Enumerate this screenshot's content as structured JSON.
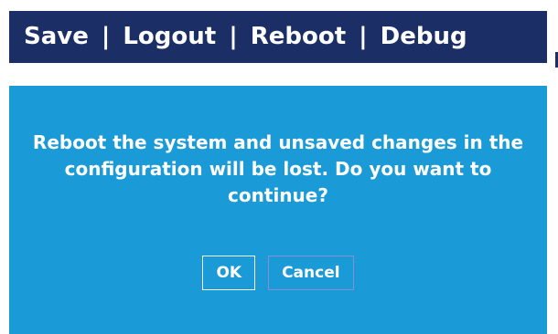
{
  "top_nav": {
    "items": [
      {
        "label": "Save"
      },
      {
        "label": "Logout"
      },
      {
        "label": "Reboot"
      },
      {
        "label": "Debug"
      }
    ],
    "separator": "|"
  },
  "dialog": {
    "message": "Reboot the system and unsaved changes in the configuration will be lost. Do you want to continue?",
    "ok_label": "OK",
    "cancel_label": "Cancel"
  },
  "colors": {
    "topbar_bg": "#1b2f66",
    "dialog_bg": "#1a9ad6",
    "text": "#ffffff"
  }
}
